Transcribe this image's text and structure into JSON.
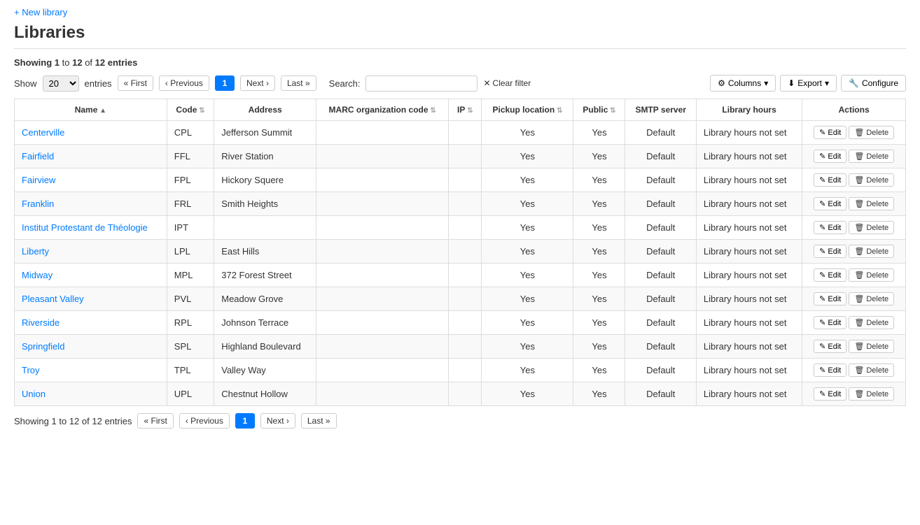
{
  "page": {
    "new_library_label": "+ New library",
    "title": "Libraries",
    "showing_prefix": "Showing",
    "showing_range_start": "1",
    "showing_range_end": "12",
    "showing_total": "12",
    "showing_suffix": "entries",
    "show_label": "Show",
    "entries_label": "entries",
    "search_label": "Search:",
    "search_placeholder": "",
    "clear_filter_label": "Clear filter",
    "columns_label": "Columns",
    "export_label": "Export",
    "configure_label": "Configure"
  },
  "pagination_top": {
    "first_label": "« First",
    "previous_label": "‹ Previous",
    "current_page": "1",
    "next_label": "Next ›",
    "last_label": "Last »"
  },
  "pagination_bottom": {
    "first_label": "« First",
    "previous_label": "‹ Previous",
    "current_page": "1",
    "next_label": "Next ›",
    "last_label": "Last »",
    "showing_prefix": "Showing",
    "showing_range_start": "1",
    "showing_range_end": "12",
    "showing_total": "12",
    "showing_suffix": "entries"
  },
  "show_options": [
    "10",
    "20",
    "50",
    "100"
  ],
  "show_selected": "20",
  "table": {
    "columns": [
      {
        "id": "name",
        "label": "Name",
        "sortable": true,
        "sorted": "asc"
      },
      {
        "id": "code",
        "label": "Code",
        "sortable": true,
        "sorted": "none"
      },
      {
        "id": "address",
        "label": "Address",
        "sortable": false
      },
      {
        "id": "marc",
        "label": "MARC organization code",
        "sortable": true,
        "sorted": "none"
      },
      {
        "id": "ip",
        "label": "IP",
        "sortable": true,
        "sorted": "none"
      },
      {
        "id": "pickup",
        "label": "Pickup location",
        "sortable": true,
        "sorted": "none"
      },
      {
        "id": "public",
        "label": "Public",
        "sortable": true,
        "sorted": "none"
      },
      {
        "id": "smtp",
        "label": "SMTP server",
        "sortable": false
      },
      {
        "id": "hours",
        "label": "Library hours",
        "sortable": false
      },
      {
        "id": "actions",
        "label": "Actions",
        "sortable": false
      }
    ],
    "rows": [
      {
        "name": "Centerville",
        "code": "CPL",
        "address": "Jefferson Summit",
        "marc": "",
        "ip": "",
        "pickup": "Yes",
        "public": "Yes",
        "smtp": "Default",
        "hours": "Library hours not set"
      },
      {
        "name": "Fairfield",
        "code": "FFL",
        "address": "River Station",
        "marc": "",
        "ip": "",
        "pickup": "Yes",
        "public": "Yes",
        "smtp": "Default",
        "hours": "Library hours not set"
      },
      {
        "name": "Fairview",
        "code": "FPL",
        "address": "Hickory Squere",
        "marc": "",
        "ip": "",
        "pickup": "Yes",
        "public": "Yes",
        "smtp": "Default",
        "hours": "Library hours not set"
      },
      {
        "name": "Franklin",
        "code": "FRL",
        "address": "Smith Heights",
        "marc": "",
        "ip": "",
        "pickup": "Yes",
        "public": "Yes",
        "smtp": "Default",
        "hours": "Library hours not set"
      },
      {
        "name": "Institut Protestant de Théologie",
        "code": "IPT",
        "address": "",
        "marc": "",
        "ip": "",
        "pickup": "Yes",
        "public": "Yes",
        "smtp": "Default",
        "hours": "Library hours not set"
      },
      {
        "name": "Liberty",
        "code": "LPL",
        "address": "East Hills",
        "marc": "",
        "ip": "",
        "pickup": "Yes",
        "public": "Yes",
        "smtp": "Default",
        "hours": "Library hours not set"
      },
      {
        "name": "Midway",
        "code": "MPL",
        "address": "372 Forest Street",
        "marc": "",
        "ip": "",
        "pickup": "Yes",
        "public": "Yes",
        "smtp": "Default",
        "hours": "Library hours not set"
      },
      {
        "name": "Pleasant Valley",
        "code": "PVL",
        "address": "Meadow Grove",
        "marc": "",
        "ip": "",
        "pickup": "Yes",
        "public": "Yes",
        "smtp": "Default",
        "hours": "Library hours not set"
      },
      {
        "name": "Riverside",
        "code": "RPL",
        "address": "Johnson Terrace",
        "marc": "",
        "ip": "",
        "pickup": "Yes",
        "public": "Yes",
        "smtp": "Default",
        "hours": "Library hours not set"
      },
      {
        "name": "Springfield",
        "code": "SPL",
        "address": "Highland Boulevard",
        "marc": "",
        "ip": "",
        "pickup": "Yes",
        "public": "Yes",
        "smtp": "Default",
        "hours": "Library hours not set"
      },
      {
        "name": "Troy",
        "code": "TPL",
        "address": "Valley Way",
        "marc": "",
        "ip": "",
        "pickup": "Yes",
        "public": "Yes",
        "smtp": "Default",
        "hours": "Library hours not set"
      },
      {
        "name": "Union",
        "code": "UPL",
        "address": "Chestnut Hollow",
        "marc": "",
        "ip": "",
        "pickup": "Yes",
        "public": "Yes",
        "smtp": "Default",
        "hours": "Library hours not set"
      }
    ],
    "edit_label": "✎ Edit",
    "delete_label": "🗑 Delete"
  }
}
